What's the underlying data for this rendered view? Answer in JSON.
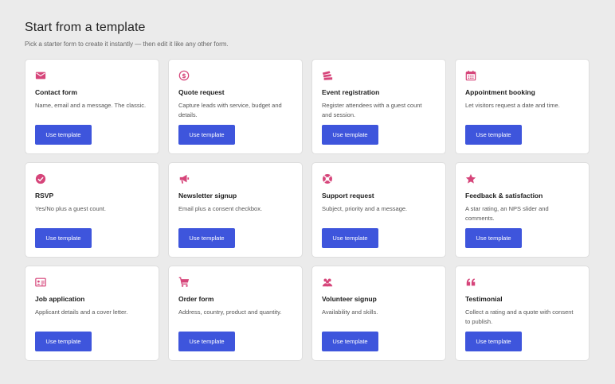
{
  "header": {
    "title": "Start from a template",
    "subtitle": "Pick a starter form to create it instantly — then edit it like any other form."
  },
  "accent_color": "#d6457a",
  "button_color": "#3e55dc",
  "templates": [
    {
      "icon": "envelope-icon",
      "title": "Contact form",
      "description": "Name, email and a message. The classic.",
      "button": "Use template"
    },
    {
      "icon": "dollar-icon",
      "title": "Quote request",
      "description": "Capture leads with service, budget and details.",
      "button": "Use template"
    },
    {
      "icon": "tickets-icon",
      "title": "Event registration",
      "description": "Register attendees with a guest count and session.",
      "button": "Use template"
    },
    {
      "icon": "calendar-icon",
      "title": "Appointment booking",
      "description": "Let visitors request a date and time.",
      "button": "Use template"
    },
    {
      "icon": "check-circle-icon",
      "title": "RSVP",
      "description": "Yes/No plus a guest count.",
      "button": "Use template"
    },
    {
      "icon": "megaphone-icon",
      "title": "Newsletter signup",
      "description": "Email plus a consent checkbox.",
      "button": "Use template"
    },
    {
      "icon": "lifebuoy-icon",
      "title": "Support request",
      "description": "Subject, priority and a message.",
      "button": "Use template"
    },
    {
      "icon": "star-icon",
      "title": "Feedback & satisfaction",
      "description": "A star rating, an NPS slider and comments.",
      "button": "Use template"
    },
    {
      "icon": "id-card-icon",
      "title": "Job application",
      "description": "Applicant details and a cover letter.",
      "button": "Use template"
    },
    {
      "icon": "cart-icon",
      "title": "Order form",
      "description": "Address, country, product and quantity.",
      "button": "Use template"
    },
    {
      "icon": "people-icon",
      "title": "Volunteer signup",
      "description": "Availability and skills.",
      "button": "Use template"
    },
    {
      "icon": "quote-icon",
      "title": "Testimonial",
      "description": "Collect a rating and a quote with consent to publish.",
      "button": "Use template"
    }
  ]
}
